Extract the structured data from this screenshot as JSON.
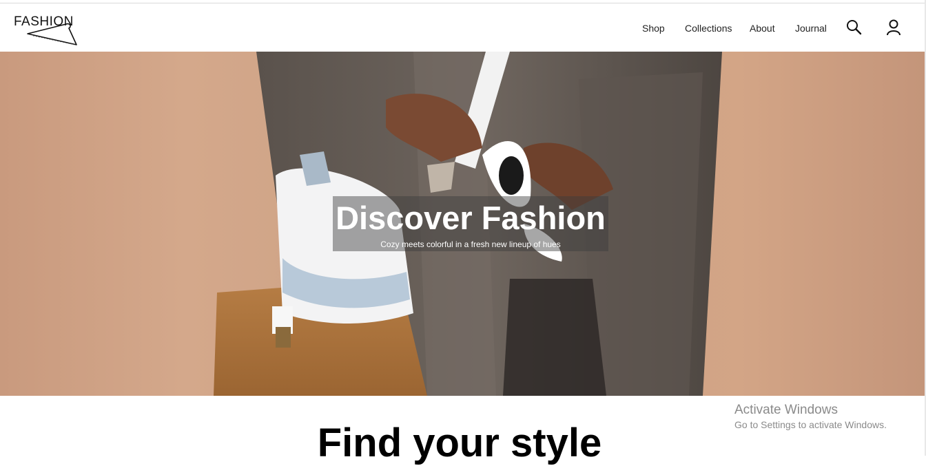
{
  "header": {
    "logo_text": "FASHION",
    "nav": [
      {
        "label": "Shop"
      },
      {
        "label": "Collections"
      },
      {
        "label": "About"
      },
      {
        "label": "Journal"
      }
    ],
    "icons": [
      "search-icon",
      "user-icon"
    ]
  },
  "hero": {
    "title": "Discover Fashion",
    "subtitle": "Cozy meets colorful in a fresh new lineup of hues"
  },
  "section": {
    "title": "Find your style"
  },
  "watermark": {
    "title": "Activate Windows",
    "subtitle": "Go to Settings to activate Windows."
  }
}
